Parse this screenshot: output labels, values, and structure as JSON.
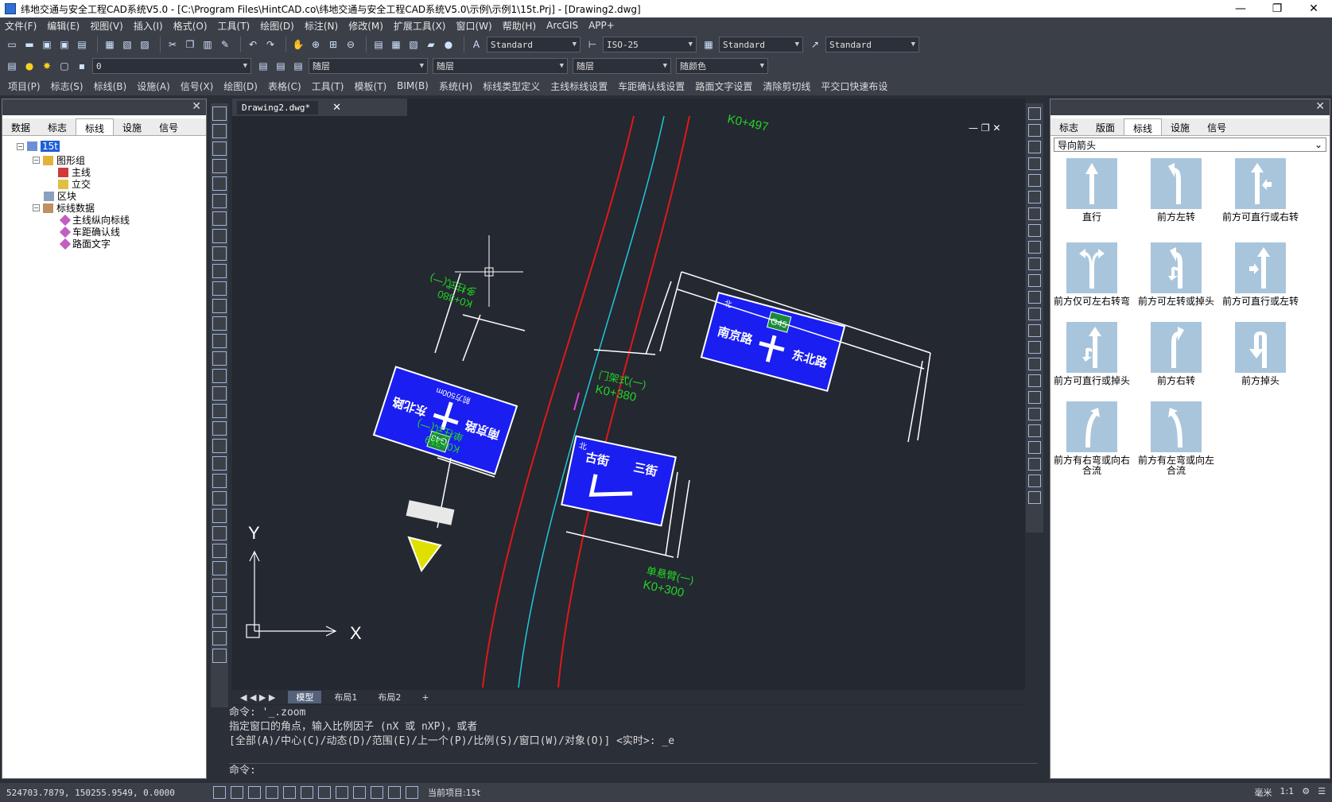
{
  "window": {
    "title": "纬地交通与安全工程CAD系统V5.0 - [C:\\Program Files\\HintCAD.co\\纬地交通与安全工程CAD系统V5.0\\示例\\示例1\\15t.Prj] - [Drawing2.dwg]",
    "minimize": "—",
    "maximize": "❐",
    "close": "✕"
  },
  "menu": [
    "文件(F)",
    "编辑(E)",
    "视图(V)",
    "插入(I)",
    "格式(O)",
    "工具(T)",
    "绘图(D)",
    "标注(N)",
    "修改(M)",
    "扩展工具(X)",
    "窗口(W)",
    "帮助(H)",
    "ArcGIS",
    "APP+"
  ],
  "toolbar1": {
    "text_style": "Standard",
    "dim_style": "ISO-25",
    "table_style": "Standard",
    "mleader_style": "Standard"
  },
  "toolbar2": {
    "layer": "0",
    "color": "随层",
    "linetype": "随层",
    "lineweight": "随层",
    "plotstyle": "随颜色"
  },
  "toolbar3": [
    "项目(P)",
    "标志(S)",
    "标线(B)",
    "设施(A)",
    "信号(X)",
    "绘图(D)",
    "表格(C)",
    "工具(T)",
    "模板(T)",
    "BIM(B)",
    "系统(H)",
    "标线类型定义",
    "主线标线设置",
    "车距确认线设置",
    "路面文字设置",
    "清除剪切线",
    "平交口快速布设"
  ],
  "left_panel": {
    "close": "✕",
    "tabs": [
      "数据",
      "标志",
      "标线",
      "设施",
      "信号"
    ],
    "active_tab": "标线",
    "tree": {
      "root": "15t",
      "group": "图形组",
      "main": "主线",
      "interchange": "立交",
      "block": "区块",
      "data": "标线数据",
      "item1": "主线纵向标线",
      "item2": "车距确认线",
      "item3": "路面文字"
    }
  },
  "document": {
    "tab": "Drawing2.dwg*",
    "close": "✕"
  },
  "drawing": {
    "labels": {
      "k497": "K0+497",
      "k380_top": "K0+380",
      "k380_type_top": "多柱式(一)",
      "k380_right": "K0+380",
      "k380_type_right": "门架式(一)",
      "k319": "K0+319",
      "k319_type": "单柱式(一)",
      "k300": "K0+300",
      "k300_type": "单悬臂(一)",
      "sign1_road_a": "南京路",
      "sign1_road_b": "东北路",
      "sign1_route": "G43",
      "sign1_dist": "前方500m",
      "sign2_road_a": "南京路",
      "sign2_road_b": "东北路",
      "sign2_route": "G45",
      "sign3_road_a": "古街",
      "sign3_road_b": "三街",
      "north": "北",
      "axis_x": "X",
      "axis_y": "Y"
    }
  },
  "layout_tabs": [
    "模型",
    "布局1",
    "布局2",
    "+"
  ],
  "active_layout": "模型",
  "command": {
    "line1": "命令: '_.zoom",
    "line2": "指定窗口的角点，输入比例因子 (nX 或 nXP)，或者",
    "line3": "[全部(A)/中心(C)/动态(D)/范围(E)/上一个(P)/比例(S)/窗口(W)/对象(O)] <实时>: _e",
    "prompt": "命令:"
  },
  "right_panel": {
    "close": "✕",
    "tabs": [
      "标志",
      "版面",
      "标线",
      "设施",
      "信号"
    ],
    "active_tab": "标线",
    "category": "导向箭头",
    "items": [
      "直行",
      "前方左转",
      "前方可直行或右转",
      "前方仅可左右转弯",
      "前方可左转或掉头",
      "前方可直行或左转",
      "前方可直行或掉头",
      "前方右转",
      "前方掉头",
      "前方有右弯或向右合流",
      "前方有左弯或向左合流"
    ]
  },
  "status": {
    "coords": "524703.7879, 150255.9549, 0.0000",
    "project": "当前项目:15t",
    "unit": "毫米",
    "scale": "1:1"
  },
  "colors": {
    "sign_blue": "#1a1ef0",
    "route_green": "#1a8a3a",
    "road_red": "#e01818",
    "center_cyan": "#1ec8d8",
    "label_green": "#22d622"
  }
}
